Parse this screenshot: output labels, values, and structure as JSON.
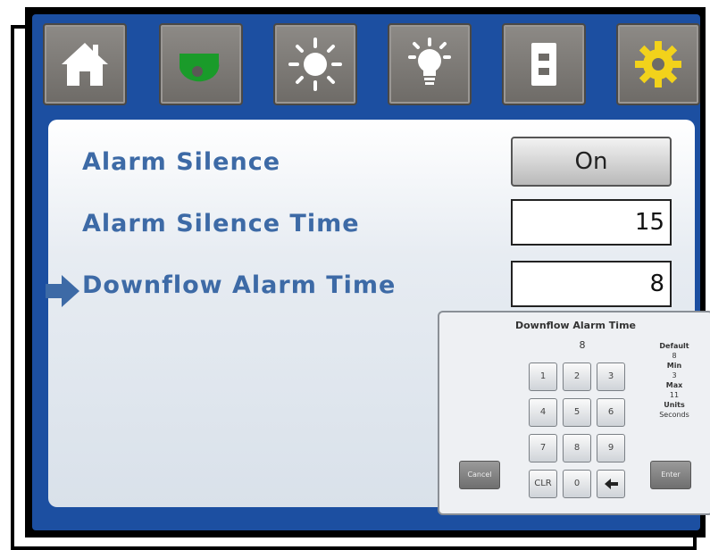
{
  "nav": {
    "buttons": [
      {
        "icon": "home-icon"
      },
      {
        "icon": "blower-icon",
        "color": "#1a9b2a"
      },
      {
        "icon": "sun-icon"
      },
      {
        "icon": "lightbulb-icon"
      },
      {
        "icon": "outlet-icon"
      },
      {
        "icon": "gear-icon",
        "color": "#f2d21b"
      }
    ]
  },
  "settings": {
    "alarm_silence": {
      "label": "Alarm Silence",
      "value": "On"
    },
    "alarm_silence_time": {
      "label": "Alarm Silence Time",
      "value": "15"
    },
    "downflow_alarm_time": {
      "label": "Downflow Alarm Time",
      "value": "8"
    }
  },
  "keypad": {
    "title": "Downflow Alarm Time",
    "current_value": "8",
    "default_label": "Default",
    "default_value": "8",
    "min_label": "Min",
    "min_value": "3",
    "max_label": "Max",
    "max_value": "11",
    "units_label": "Units",
    "units_value": "Seconds",
    "keys": [
      "1",
      "2",
      "3",
      "4",
      "5",
      "6",
      "7",
      "8",
      "9",
      "CLR",
      "0"
    ],
    "cancel_label": "Cancel",
    "enter_label": "Enter"
  },
  "colors": {
    "accent": "#1c4fa1",
    "label_text": "#3d6aa6"
  }
}
